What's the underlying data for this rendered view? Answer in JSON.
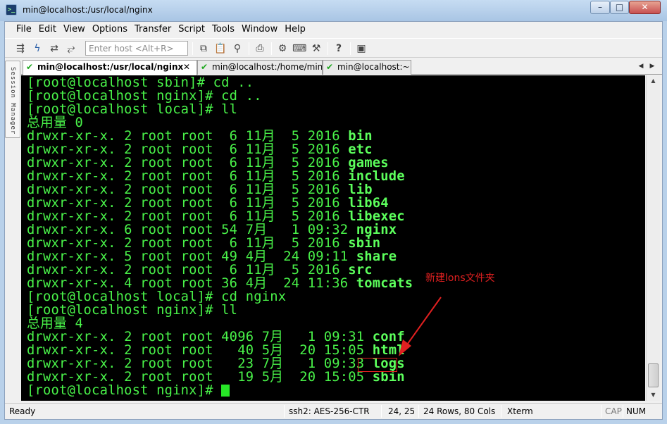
{
  "window": {
    "title": "min@localhost:/usr/local/nginx",
    "icon": "securecrt-terminal-icon",
    "minimize": "–",
    "maximize": "□",
    "close": "✕"
  },
  "menu": [
    "File",
    "Edit",
    "View",
    "Options",
    "Transfer",
    "Script",
    "Tools",
    "Window",
    "Help"
  ],
  "toolbar": {
    "host_placeholder": "Enter host <Alt+R>",
    "icons": [
      "connect-icon",
      "quick-connect-icon",
      "reconnect-icon",
      "disconnect-icon",
      "copy-icon",
      "paste-icon",
      "find-icon",
      "print-icon",
      "settings-icon",
      "keymap-icon",
      "sftp-icon",
      "help-icon",
      "session-options-icon"
    ]
  },
  "session_manager": {
    "label": "Session Manager"
  },
  "tabs": [
    {
      "label": "min@localhost:/usr/local/nginx",
      "active": true
    },
    {
      "label": "min@localhost:/home/min",
      "active": false
    },
    {
      "label": "min@localhost:~",
      "active": false
    }
  ],
  "terminal": {
    "lines": [
      {
        "text": "[root@localhost sbin]# cd ..",
        "bold": ""
      },
      {
        "text": "[root@localhost nginx]# cd ..",
        "bold": ""
      },
      {
        "text": "[root@localhost local]# ll",
        "bold": ""
      },
      {
        "text": "总用量 0",
        "bold": ""
      },
      {
        "text": "drwxr-xr-x. 2 root root  6 11月  5 2016 ",
        "bold": "bin"
      },
      {
        "text": "drwxr-xr-x. 2 root root  6 11月  5 2016 ",
        "bold": "etc"
      },
      {
        "text": "drwxr-xr-x. 2 root root  6 11月  5 2016 ",
        "bold": "games"
      },
      {
        "text": "drwxr-xr-x. 2 root root  6 11月  5 2016 ",
        "bold": "include"
      },
      {
        "text": "drwxr-xr-x. 2 root root  6 11月  5 2016 ",
        "bold": "lib"
      },
      {
        "text": "drwxr-xr-x. 2 root root  6 11月  5 2016 ",
        "bold": "lib64"
      },
      {
        "text": "drwxr-xr-x. 2 root root  6 11月  5 2016 ",
        "bold": "libexec"
      },
      {
        "text": "drwxr-xr-x. 6 root root 54 7月   1 09:32 ",
        "bold": "nginx"
      },
      {
        "text": "drwxr-xr-x. 2 root root  6 11月  5 2016 ",
        "bold": "sbin"
      },
      {
        "text": "drwxr-xr-x. 5 root root 49 4月  24 09:11 ",
        "bold": "share"
      },
      {
        "text": "drwxr-xr-x. 2 root root  6 11月  5 2016 ",
        "bold": "src"
      },
      {
        "text": "drwxr-xr-x. 4 root root 36 4月  24 11:36 ",
        "bold": "tomcats"
      },
      {
        "text": "[root@localhost local]# cd nginx",
        "bold": ""
      },
      {
        "text": "[root@localhost nginx]# ll",
        "bold": ""
      },
      {
        "text": "总用量 4",
        "bold": ""
      },
      {
        "text": "drwxr-xr-x. 2 root root 4096 7月   1 09:31 ",
        "bold": "conf"
      },
      {
        "text": "drwxr-xr-x. 2 root root   40 5月  20 15:05 ",
        "bold": "html"
      },
      {
        "text": "drwxr-xr-x. 2 root root   23 7月   1 09:33 ",
        "bold": "logs"
      },
      {
        "text": "drwxr-xr-x. 2 root root   19 5月  20 15:05 ",
        "bold": "sbin"
      },
      {
        "text": "[root@localhost nginx]# ",
        "bold": ""
      }
    ],
    "foreground": "#49f249",
    "background": "#000000"
  },
  "annotation": {
    "text": "新建lons文件夹",
    "color": "#e02020"
  },
  "status": {
    "ready": "Ready",
    "cipher": "ssh2: AES-256-CTR",
    "position": "24,  25",
    "size": "24 Rows, 80 Cols",
    "terminal_type": "Xterm",
    "cap": "CAP",
    "num": "NUM"
  }
}
